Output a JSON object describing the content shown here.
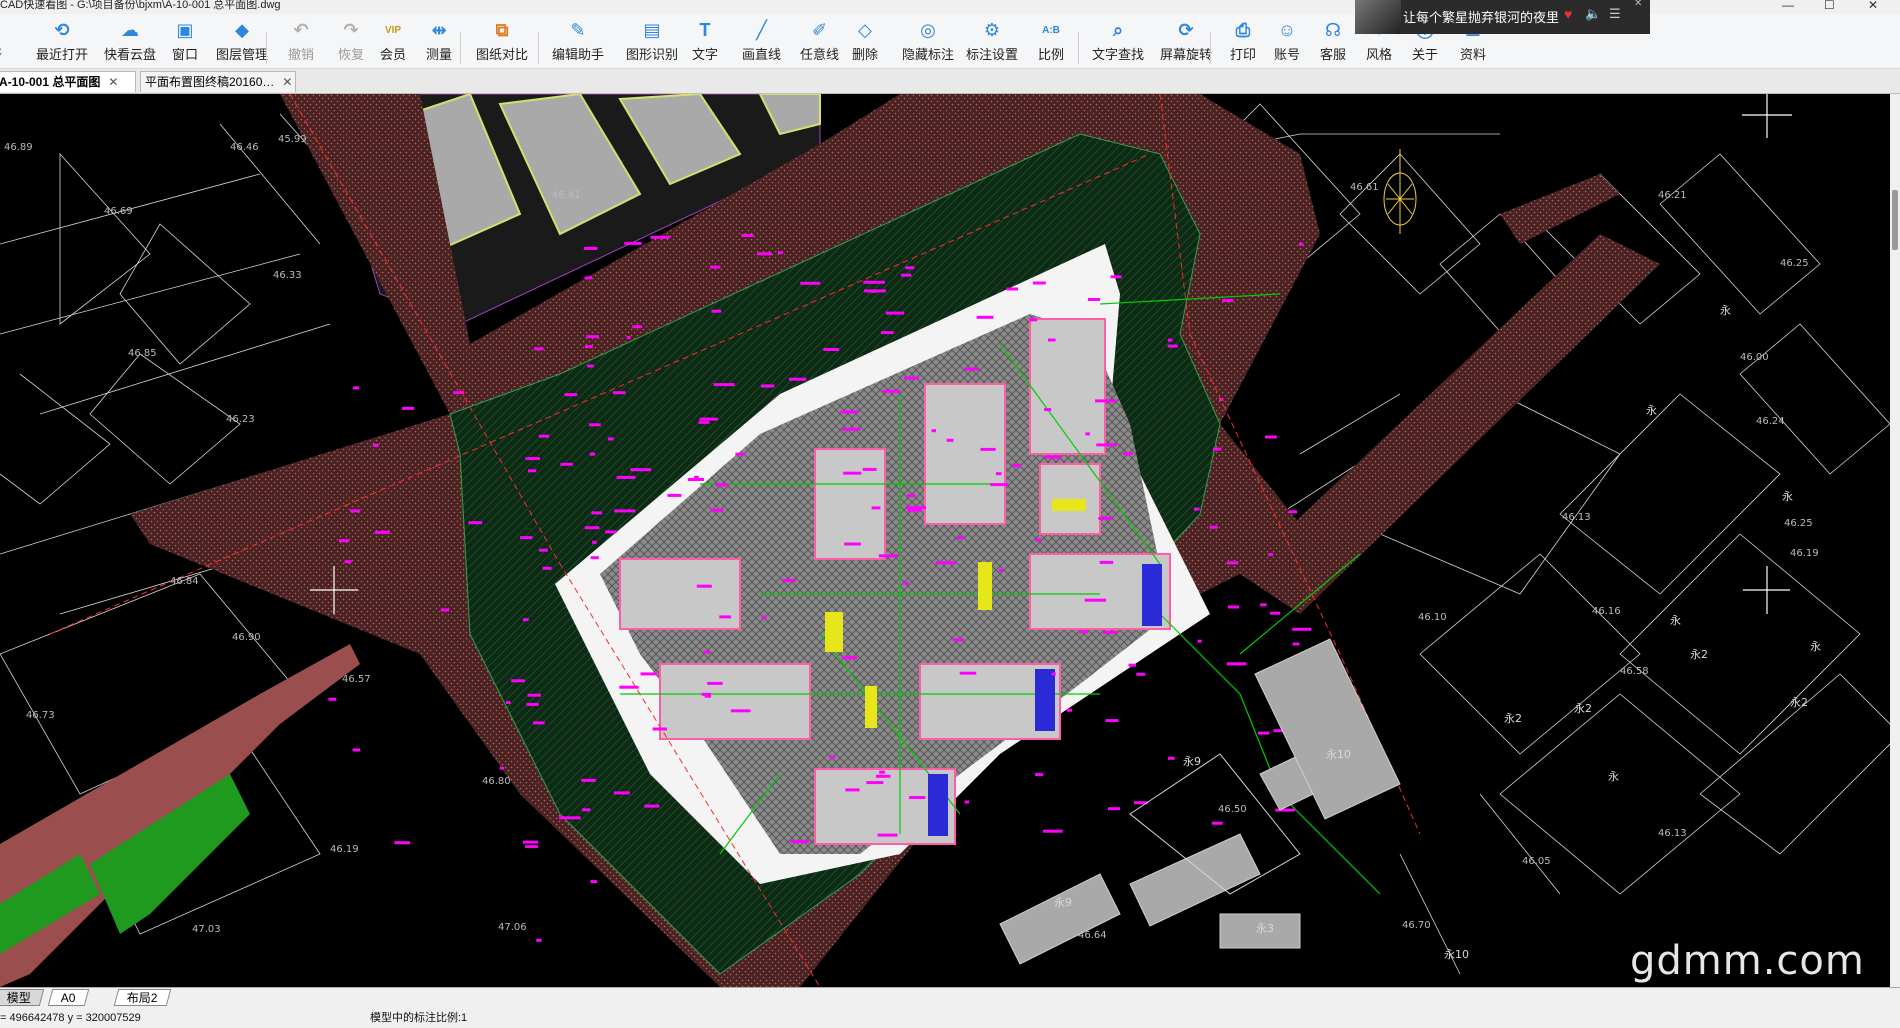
{
  "window": {
    "title": "CAD快速看图 - G:\\项目备份\\bjxm\\A-10-001 总平面图.dwg",
    "controls": [
      "—",
      "☐",
      "✕"
    ]
  },
  "toolbar": {
    "items": [
      {
        "name": "open",
        "label": "打开",
        "icon": "folder-icon",
        "enabled": true
      },
      {
        "name": "recent",
        "label": "最近打开",
        "icon": "clock-icon",
        "enabled": true
      },
      {
        "name": "cloud",
        "label": "快看云盘",
        "icon": "cloud-icon",
        "enabled": true
      },
      {
        "name": "window",
        "label": "窗口",
        "icon": "window-icon",
        "enabled": true
      },
      {
        "name": "layers",
        "label": "图层管理",
        "icon": "layers-icon",
        "enabled": true
      },
      {
        "name": "undo",
        "label": "撤销",
        "icon": "undo-icon",
        "enabled": false
      },
      {
        "name": "redo",
        "label": "恢复",
        "icon": "redo-icon",
        "enabled": false
      },
      {
        "name": "vip",
        "label": "会员",
        "icon": "vip-icon",
        "enabled": true
      },
      {
        "name": "measure",
        "label": "测量",
        "icon": "measure-icon",
        "enabled": true
      },
      {
        "name": "compare",
        "label": "图纸对比",
        "icon": "compare-icon",
        "enabled": true
      },
      {
        "name": "edit",
        "label": "编辑助手",
        "icon": "edit-assistant-icon",
        "enabled": true
      },
      {
        "name": "recognize",
        "label": "图形识别",
        "icon": "shape-recognize-icon",
        "enabled": true
      },
      {
        "name": "text",
        "label": "文字",
        "icon": "text-icon",
        "enabled": true
      },
      {
        "name": "line",
        "label": "画直线",
        "icon": "line-icon",
        "enabled": true
      },
      {
        "name": "freehand",
        "label": "任意线",
        "icon": "pen-icon",
        "enabled": true
      },
      {
        "name": "delete",
        "label": "删除",
        "icon": "eraser-icon",
        "enabled": true
      },
      {
        "name": "hide",
        "label": "隐藏标注",
        "icon": "eye-hide-icon",
        "enabled": true
      },
      {
        "name": "dimset",
        "label": "标注设置",
        "icon": "dim-settings-icon",
        "enabled": true
      },
      {
        "name": "ratio",
        "label": "比例",
        "icon": "ratio-icon",
        "enabled": true
      },
      {
        "name": "find",
        "label": "文字查找",
        "icon": "find-text-icon",
        "enabled": true
      },
      {
        "name": "rotate",
        "label": "屏幕旋转",
        "icon": "rotate-screen-icon",
        "enabled": true
      },
      {
        "name": "print",
        "label": "打印",
        "icon": "printer-icon",
        "enabled": true
      },
      {
        "name": "account",
        "label": "账号",
        "icon": "user-icon",
        "enabled": true
      },
      {
        "name": "support",
        "label": "客服",
        "icon": "headset-icon",
        "enabled": true
      },
      {
        "name": "style",
        "label": "风格",
        "icon": "style-icon",
        "enabled": true
      },
      {
        "name": "about",
        "label": "关于",
        "icon": "info-icon",
        "enabled": true
      },
      {
        "name": "docs",
        "label": "资料",
        "icon": "docs-icon",
        "enabled": true
      }
    ]
  },
  "music_popup": {
    "song": "让每个繁星抛弃银河的夜里",
    "icons": [
      "heart-icon",
      "volume-icon",
      "playlist-icon",
      "close-icon"
    ]
  },
  "tabs": [
    {
      "label": "A-10-001 总平面图",
      "active": true
    },
    {
      "label": "平面布置图终稿20160…",
      "active": false
    }
  ],
  "layout_tabs": [
    {
      "label": "模型",
      "active": true
    },
    {
      "label": "A0",
      "active": false
    },
    {
      "label": "布局2",
      "active": false
    }
  ],
  "status": {
    "coords": "= 496642478 y = 320007529",
    "scale": "模型中的标注比例:1"
  },
  "drawing": {
    "elevations": [
      "46.89",
      "46.46",
      "45.99",
      "46.69",
      "46.33",
      "46.85",
      "46.23",
      "46.84",
      "46.90",
      "46.57",
      "46.73",
      "46.80",
      "46.19",
      "47.03",
      "47.06",
      "46.64",
      "46.50",
      "46.70",
      "46.13",
      "46.16",
      "46.10",
      "46.05",
      "46.13",
      "46.25",
      "46.19",
      "46.24",
      "46.00",
      "46.25",
      "46.21",
      "46.41",
      "46.61",
      "46.58"
    ],
    "building_labels": [
      "永9",
      "永9",
      "永10",
      "永2",
      "永2",
      "永2",
      "永",
      "永",
      "永",
      "永",
      "永",
      "永10",
      "永2",
      "永3",
      "永"
    ]
  },
  "watermark": "gdmm.com",
  "colors": {
    "road": "#5a2a2a",
    "green": "#0c3a1a",
    "magenta": "#ff00ff",
    "building": "#b8b8b8",
    "line_green": "#00cc00",
    "accent_blue": "#1e88e5"
  }
}
